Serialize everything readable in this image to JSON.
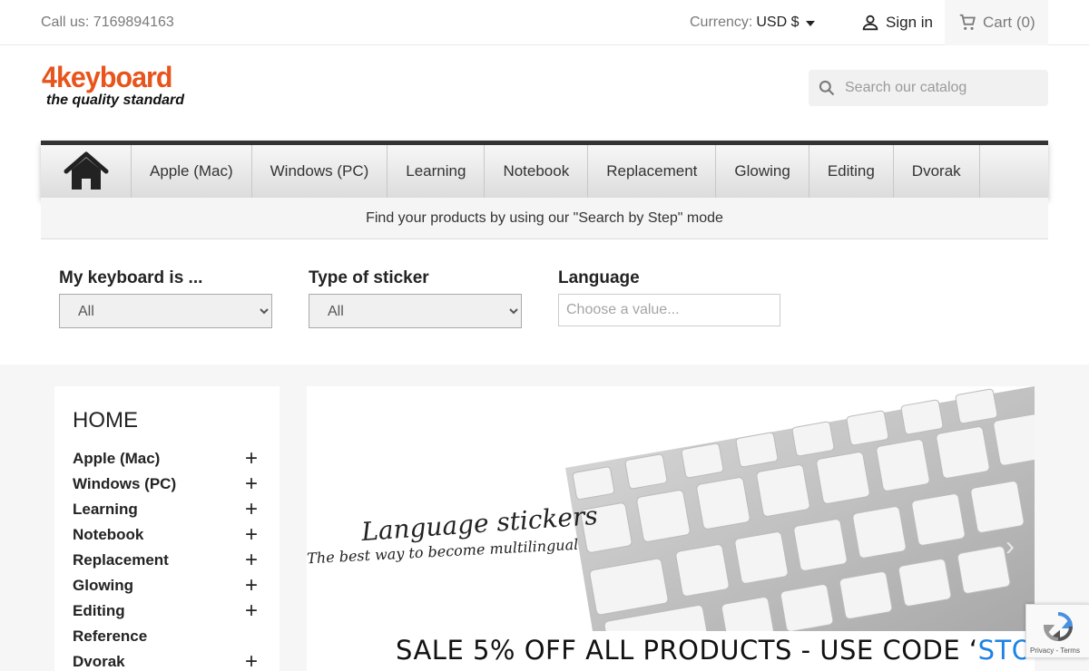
{
  "topbar": {
    "call_us": "Call us: 7169894163",
    "currency_label": "Currency:",
    "currency_value": "USD $",
    "signin": "Sign in",
    "cart": "Cart (0)"
  },
  "logo": {
    "name": "4keyboard",
    "tagline": "the quality standard"
  },
  "search": {
    "placeholder": "Search our catalog"
  },
  "nav": {
    "items": [
      {
        "label": "Apple (Mac)"
      },
      {
        "label": "Windows (PC)"
      },
      {
        "label": "Learning"
      },
      {
        "label": "Notebook"
      },
      {
        "label": "Replacement"
      },
      {
        "label": "Glowing"
      },
      {
        "label": "Editing"
      },
      {
        "label": "Dvorak"
      }
    ],
    "search_step_text": "Find your products by using our \"Search by Step\" mode"
  },
  "filters": {
    "keyboard": {
      "label": "My keyboard is ...",
      "value": "All"
    },
    "sticker": {
      "label": "Type of sticker",
      "value": "All"
    },
    "language": {
      "label": "Language",
      "placeholder": "Choose a value..."
    }
  },
  "sidebar": {
    "title": "HOME",
    "items": [
      {
        "label": "Apple (Mac)",
        "expandable": true
      },
      {
        "label": "Windows (PC)",
        "expandable": true
      },
      {
        "label": "Learning",
        "expandable": true
      },
      {
        "label": "Notebook",
        "expandable": true
      },
      {
        "label": "Replacement",
        "expandable": true
      },
      {
        "label": "Glowing",
        "expandable": true
      },
      {
        "label": "Editing",
        "expandable": true
      },
      {
        "label": "Reference",
        "expandable": false
      },
      {
        "label": "Dvorak",
        "expandable": true
      }
    ]
  },
  "banner": {
    "script_line1": "Language stickers",
    "script_line2": "The best way to become multilingual",
    "sale_prefix": "SALE 5% OFF ALL PRODUCTS - USE CODE ‘",
    "sale_code": "STORE",
    "sale_suffix": "’"
  },
  "recaptcha": {
    "text": "Privacy - Terms"
  },
  "colors": {
    "brand": "#e8541b",
    "accent": "#1e82e6"
  }
}
